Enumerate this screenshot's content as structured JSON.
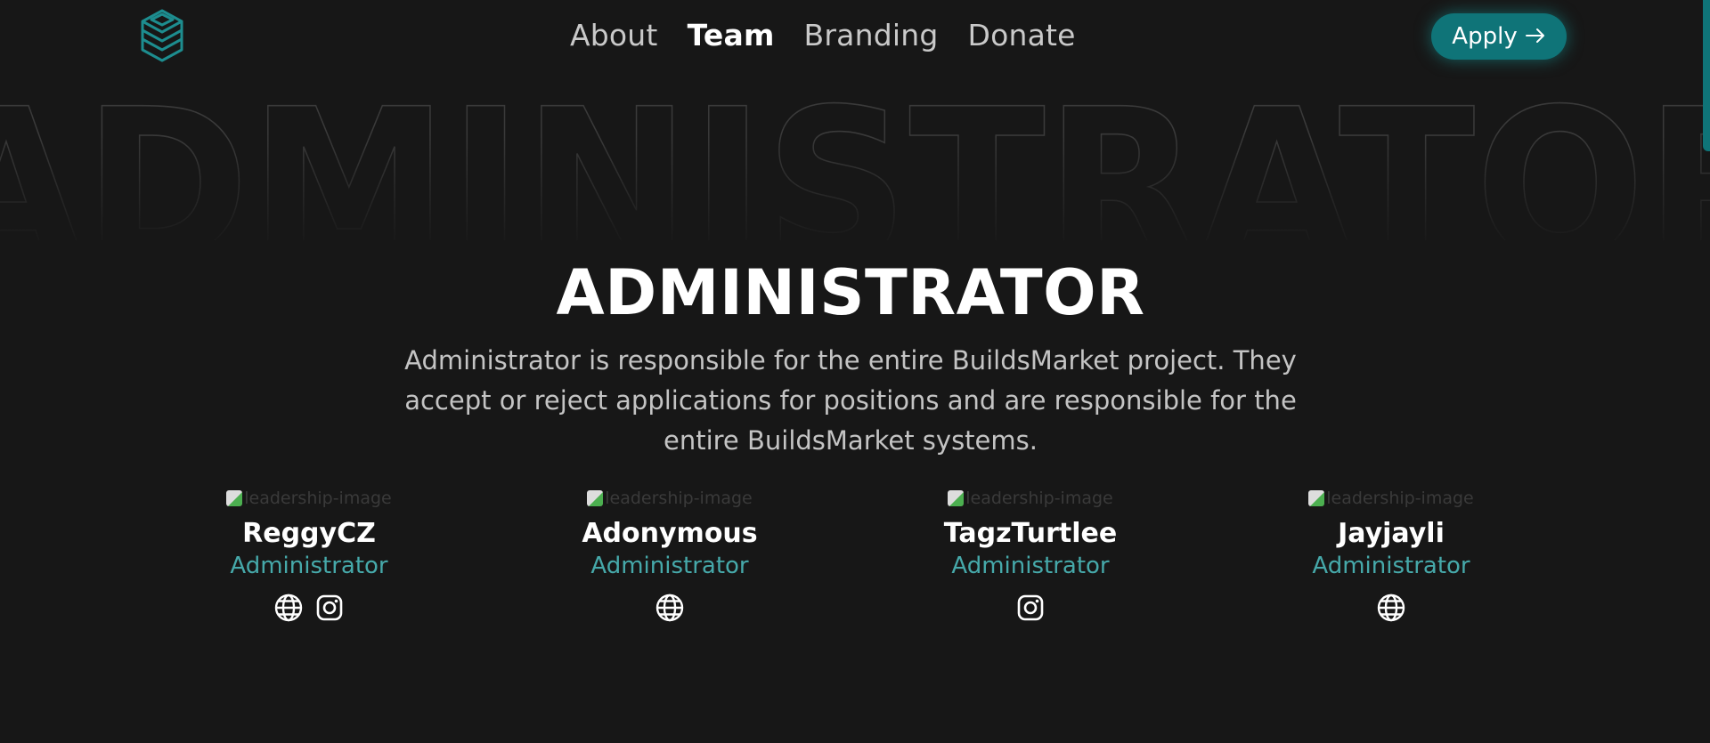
{
  "brand": {
    "accent": "#0f7478",
    "teal_text": "#46a9aa",
    "background": "#171717"
  },
  "header": {
    "logo_icon": "stacked-cube-logo-icon",
    "nav": [
      {
        "label": "About",
        "active": false
      },
      {
        "label": "Team",
        "active": true
      },
      {
        "label": "Branding",
        "active": false
      },
      {
        "label": "Donate",
        "active": false
      }
    ],
    "apply_label": "Apply",
    "apply_icon": "arrow-right-icon"
  },
  "hero": {
    "background_word": "ADMINISTRATOR",
    "title": "ADMINISTRATOR",
    "description": "Administrator is responsible for the entire BuildsMarket project. They accept or reject applications for positions and are responsible for the entire BuildsMarket systems."
  },
  "team": [
    {
      "image_alt": "leadership-image",
      "name": "ReggyCZ",
      "role": "Administrator",
      "links": [
        "globe-icon",
        "instagram-icon"
      ]
    },
    {
      "image_alt": "leadership-image",
      "name": "Adonymous",
      "role": "Administrator",
      "links": [
        "globe-icon"
      ]
    },
    {
      "image_alt": "leadership-image",
      "name": "TagzTurtlee",
      "role": "Administrator",
      "links": [
        "instagram-icon"
      ]
    },
    {
      "image_alt": "leadership-image",
      "name": "Jayjayli",
      "role": "Administrator",
      "links": [
        "globe-icon"
      ]
    }
  ]
}
